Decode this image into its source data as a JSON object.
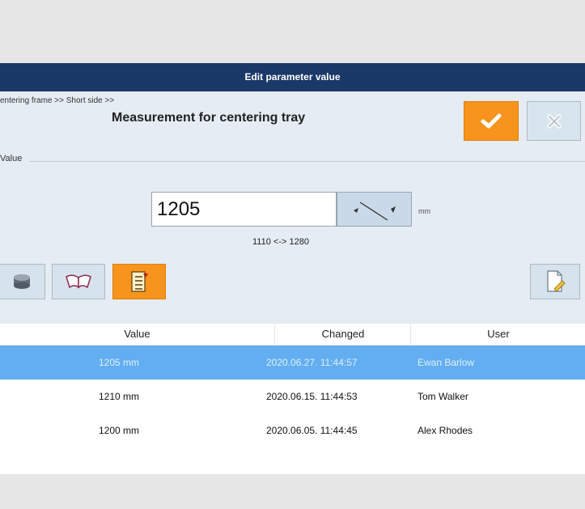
{
  "window": {
    "title": "Edit parameter value"
  },
  "header": {
    "breadcrumb": "entering frame >> Short side >>",
    "title": "Measurement for centering tray",
    "ok_icon": "checkmark-icon",
    "cancel_icon": "x-icon"
  },
  "value_section": {
    "legend": "Value",
    "current_value": "1205",
    "unit": "mm",
    "range": "1110 <-> 1280"
  },
  "toolbar": {
    "left_icons": [
      "database-icon",
      "open-book-icon",
      "history-list-icon"
    ],
    "right_icon": "edit-document-icon"
  },
  "history_table": {
    "columns": [
      "Value",
      "Changed",
      "User"
    ],
    "rows": [
      {
        "value": "1205 mm",
        "changed": "2020.06.27. 11:44:57",
        "user": "Ewan Barlow",
        "selected": true
      },
      {
        "value": "1210 mm",
        "changed": "2020.06.15. 11:44:53",
        "user": "Tom Walker",
        "selected": false
      },
      {
        "value": "1200 mm",
        "changed": "2020.06.05. 11:44:45",
        "user": "Alex Rhodes",
        "selected": false
      }
    ]
  },
  "colors": {
    "titlebar": "#1a3868",
    "accent_orange": "#f7941d",
    "selection": "#62aef0",
    "panel": "#e5ecf3"
  }
}
